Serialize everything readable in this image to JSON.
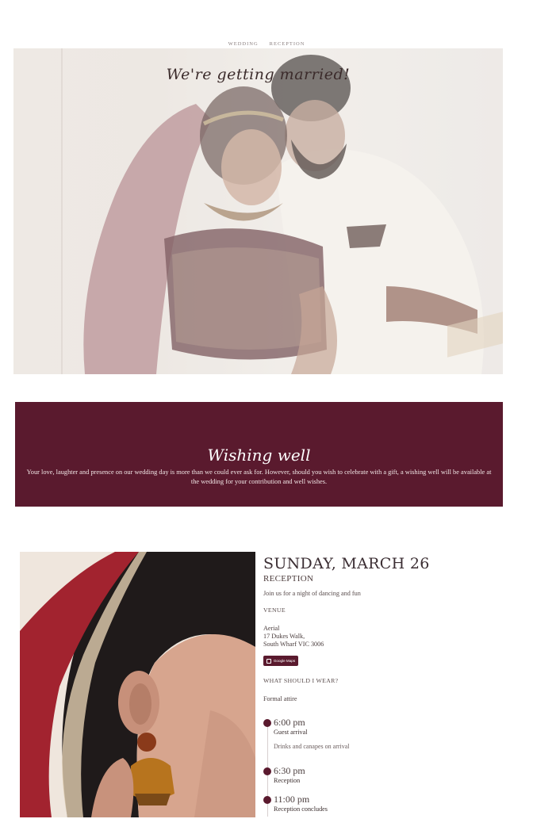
{
  "nav": {
    "items": [
      "WEDDING",
      "RECEPTION"
    ]
  },
  "hero": {
    "title": "We're getting married!"
  },
  "wishing_well": {
    "title": "Wishing well",
    "text": "Your love, laughter and presence on our wedding day is more than we could ever ask for. However, should you wish to celebrate with a gift, a wishing well will be available at the wedding for your contribution and well wishes."
  },
  "event": {
    "date": "SUNDAY, MARCH 26",
    "name": "RECEPTION",
    "description": "Join us for a night of dancing and fun",
    "venue_heading": "VENUE",
    "venue_name": "Aerial",
    "venue_street": "17 Dukes Walk,",
    "venue_city": "South Wharf VIC 3006",
    "maps_button": "Google Maps",
    "wear_heading": "WHAT SHOULD I WEAR?",
    "wear_value": "Formal attire",
    "timeline": [
      {
        "time": "6:00 pm",
        "label": "Guest arrival",
        "note": "Drinks and canapes on arrival"
      },
      {
        "time": "6:30 pm",
        "label": "Reception",
        "note": ""
      },
      {
        "time": "11:00 pm",
        "label": "Reception concludes",
        "note": ""
      }
    ]
  },
  "colors": {
    "accent": "#5a1a2e",
    "text": "#3b2e2e"
  }
}
